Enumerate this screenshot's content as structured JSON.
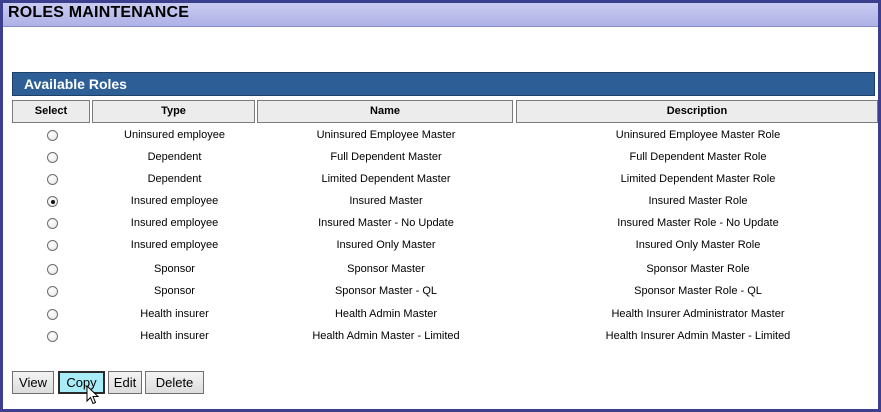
{
  "window": {
    "title": "ROLES MAINTENANCE"
  },
  "panel": {
    "title": "Available Roles"
  },
  "columns": {
    "select": "Select",
    "type": "Type",
    "name": "Name",
    "description": "Description"
  },
  "rows": [
    {
      "type": "Uninsured employee",
      "name": "Uninsured Employee Master",
      "description": "Uninsured Employee Master Role",
      "selected": false
    },
    {
      "type": "Dependent",
      "name": "Full Dependent Master",
      "description": "Full Dependent Master Role",
      "selected": false
    },
    {
      "type": "Dependent",
      "name": "Limited Dependent Master",
      "description": "Limited Dependent Master Role",
      "selected": false
    },
    {
      "type": "Insured employee",
      "name": "Insured Master",
      "description": "Insured Master Role",
      "selected": true
    },
    {
      "type": "Insured employee",
      "name": "Insured Master - No Update",
      "description": "Insured Master Role - No Update",
      "selected": false
    },
    {
      "type": "Insured employee",
      "name": "Insured Only Master",
      "description": "Insured Only Master Role",
      "selected": false
    },
    {
      "type": "Sponsor",
      "name": "Sponsor Master",
      "description": "Sponsor Master Role",
      "selected": false
    },
    {
      "type": "Sponsor",
      "name": "Sponsor Master - QL",
      "description": "Sponsor Master Role - QL",
      "selected": false
    },
    {
      "type": "Health insurer",
      "name": "Health Admin Master",
      "description": "Health Insurer Administrator Master",
      "selected": false
    },
    {
      "type": "Health insurer",
      "name": "Health Admin Master - Limited",
      "description": "Health Insurer Admin Master - Limited",
      "selected": false
    }
  ],
  "buttons": {
    "view": "View",
    "copy": "Copy",
    "edit": "Edit",
    "delete": "Delete"
  },
  "colors": {
    "panel_header": "#2d5f96",
    "title_bar": "#aeb1e6",
    "window_border": "#3c3f8e",
    "hover_button": "#a8ecf7"
  },
  "icons": {
    "cursor": "mouse-pointer-icon"
  }
}
